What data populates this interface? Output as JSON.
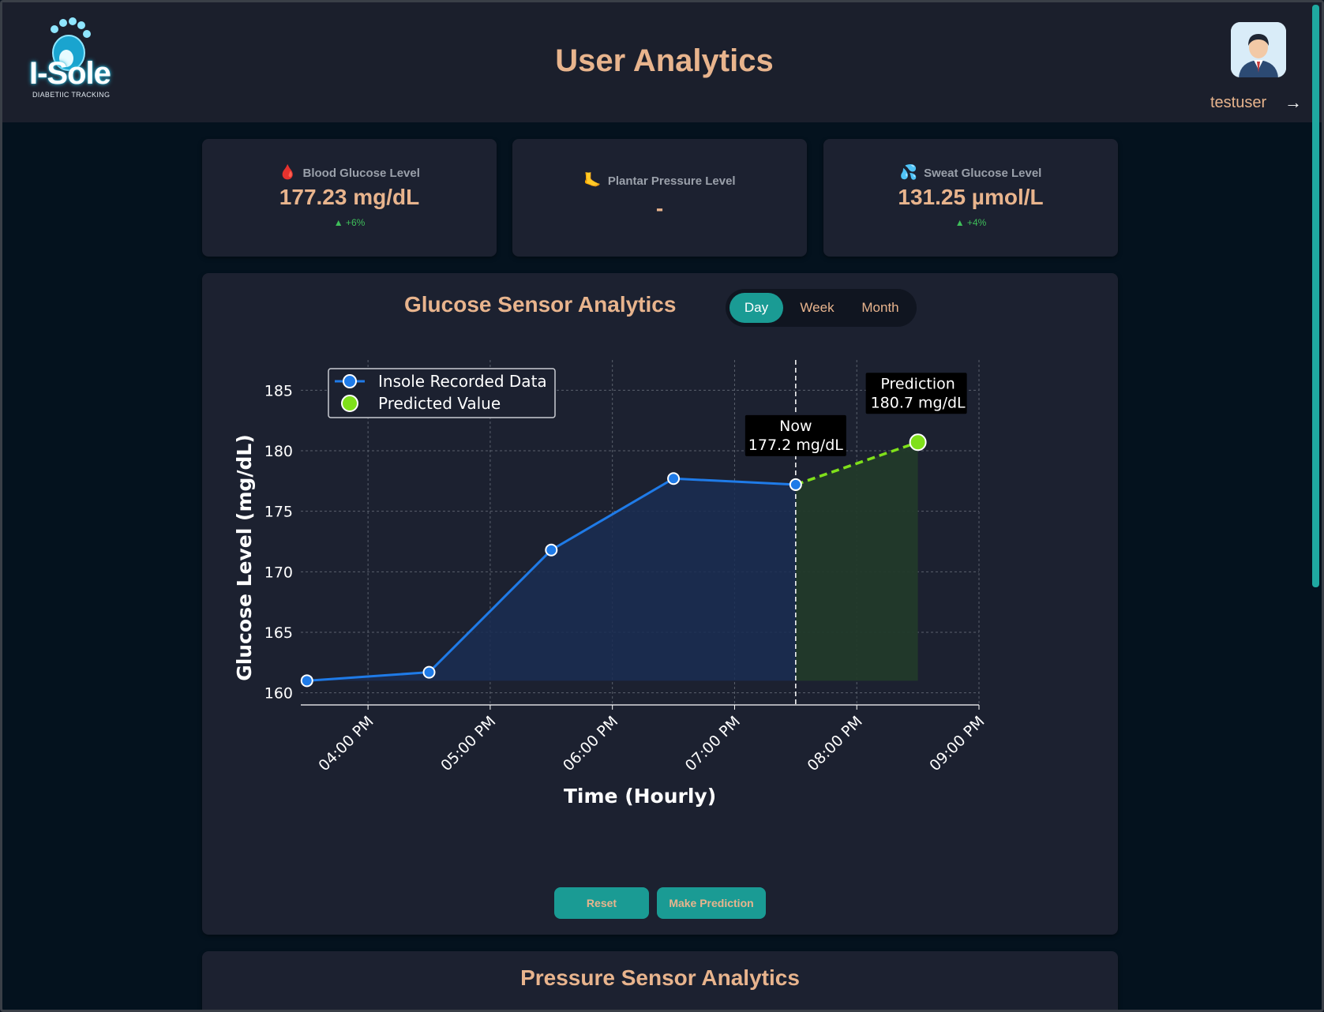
{
  "header": {
    "logo_text": "I-Sole",
    "logo_sub": "DIABETIIC TRACKING",
    "title": "User Analytics",
    "username": "testuser",
    "logout_icon": "→"
  },
  "stats": [
    {
      "icon": "blood-drop-icon",
      "glyph": "🩸",
      "label": "Blood Glucose Level",
      "value": "177.23 mg/dL",
      "change": "▲ +6%"
    },
    {
      "icon": "foot-icon",
      "glyph": "🦶",
      "label": "Plantar Pressure Level",
      "value": "-",
      "change": ""
    },
    {
      "icon": "sweat-drops-icon",
      "glyph": "💦",
      "label": "Sweat Glucose Level",
      "value": "131.25 µmol/L",
      "change": "▲ +4%"
    }
  ],
  "glucose": {
    "title": "Glucose Sensor Analytics",
    "tabs": [
      "Day",
      "Week",
      "Month"
    ],
    "active_tab": "Day",
    "reset_label": "Reset",
    "predict_label": "Make Prediction"
  },
  "pressure": {
    "title": "Pressure Sensor Analytics"
  },
  "colors": {
    "accent": "#1a9b94",
    "title": "#e8b48d",
    "recorded": "#1f7be8",
    "predicted": "#7fe01a"
  },
  "chart_data": {
    "type": "line",
    "xlabel": "Time (Hourly)",
    "ylabel": "Glucose Level (mg/dL)",
    "ylim": [
      159.0,
      187.5
    ],
    "xlim": [
      "03:27 PM",
      "09:00 PM"
    ],
    "y_ticks": [
      160,
      165,
      170,
      175,
      180,
      185
    ],
    "x_ticks": [
      "04:00 PM",
      "05:00 PM",
      "06:00 PM",
      "07:00 PM",
      "08:00 PM",
      "09:00 PM"
    ],
    "grid": true,
    "legend_position": "top-left",
    "series": [
      {
        "name": "Insole Recorded Data",
        "x": [
          "03:30 PM",
          "04:30 PM",
          "05:30 PM",
          "06:30 PM",
          "07:30 PM"
        ],
        "values": [
          161.0,
          161.7,
          171.8,
          177.7,
          177.2
        ]
      },
      {
        "name": "Predicted Value",
        "x": [
          "07:30 PM",
          "08:30 PM"
        ],
        "values": [
          177.2,
          180.7
        ]
      }
    ],
    "now_marker": "07:30 PM",
    "annotations": [
      {
        "lines": [
          "Now",
          "177.2 mg/dL"
        ],
        "at": "07:30 PM",
        "value": 177.2
      },
      {
        "lines": [
          "Prediction",
          "180.7 mg/dL"
        ],
        "at": "08:30 PM",
        "value": 180.7
      }
    ]
  }
}
